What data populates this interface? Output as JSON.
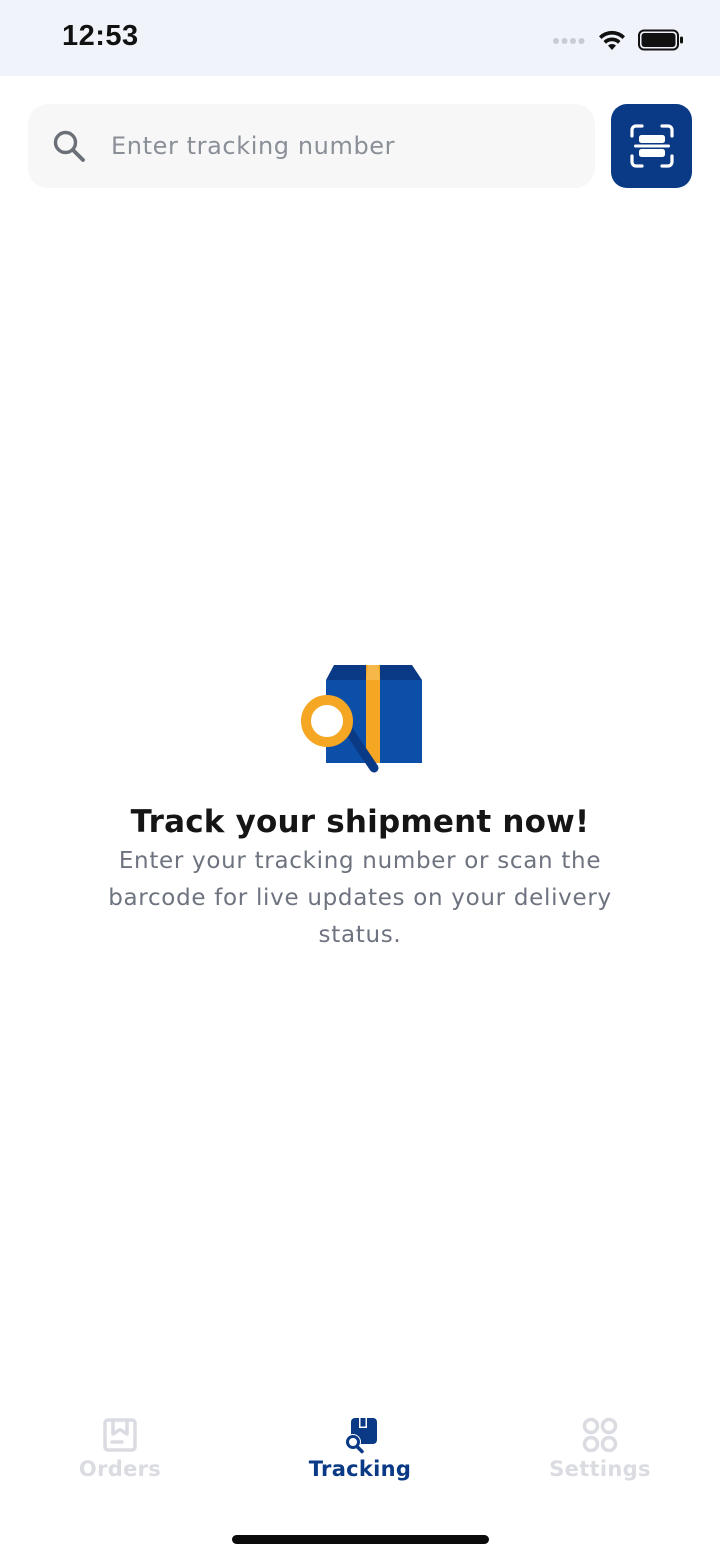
{
  "status_bar": {
    "time": "12:53"
  },
  "search": {
    "placeholder": "Enter tracking number",
    "value": "",
    "icon": "search-icon",
    "scan_icon": "barcode-scan-icon"
  },
  "empty_state": {
    "illustration": "package-search-illustration",
    "title": "Track your shipment now!",
    "description": "Enter your tracking number or scan the barcode for live updates on your delivery status."
  },
  "tab_bar": {
    "active": "Tracking",
    "tabs": [
      {
        "label": "Orders",
        "icon": "orders-icon"
      },
      {
        "label": "Tracking",
        "icon": "tracking-icon"
      },
      {
        "label": "Settings",
        "icon": "settings-icon"
      }
    ]
  },
  "colors": {
    "brand_primary": "#0a3a85",
    "brand_accent": "#f5a623",
    "status_bar_bg": "#f0f3fa",
    "inactive_tab": "#dadce2"
  }
}
